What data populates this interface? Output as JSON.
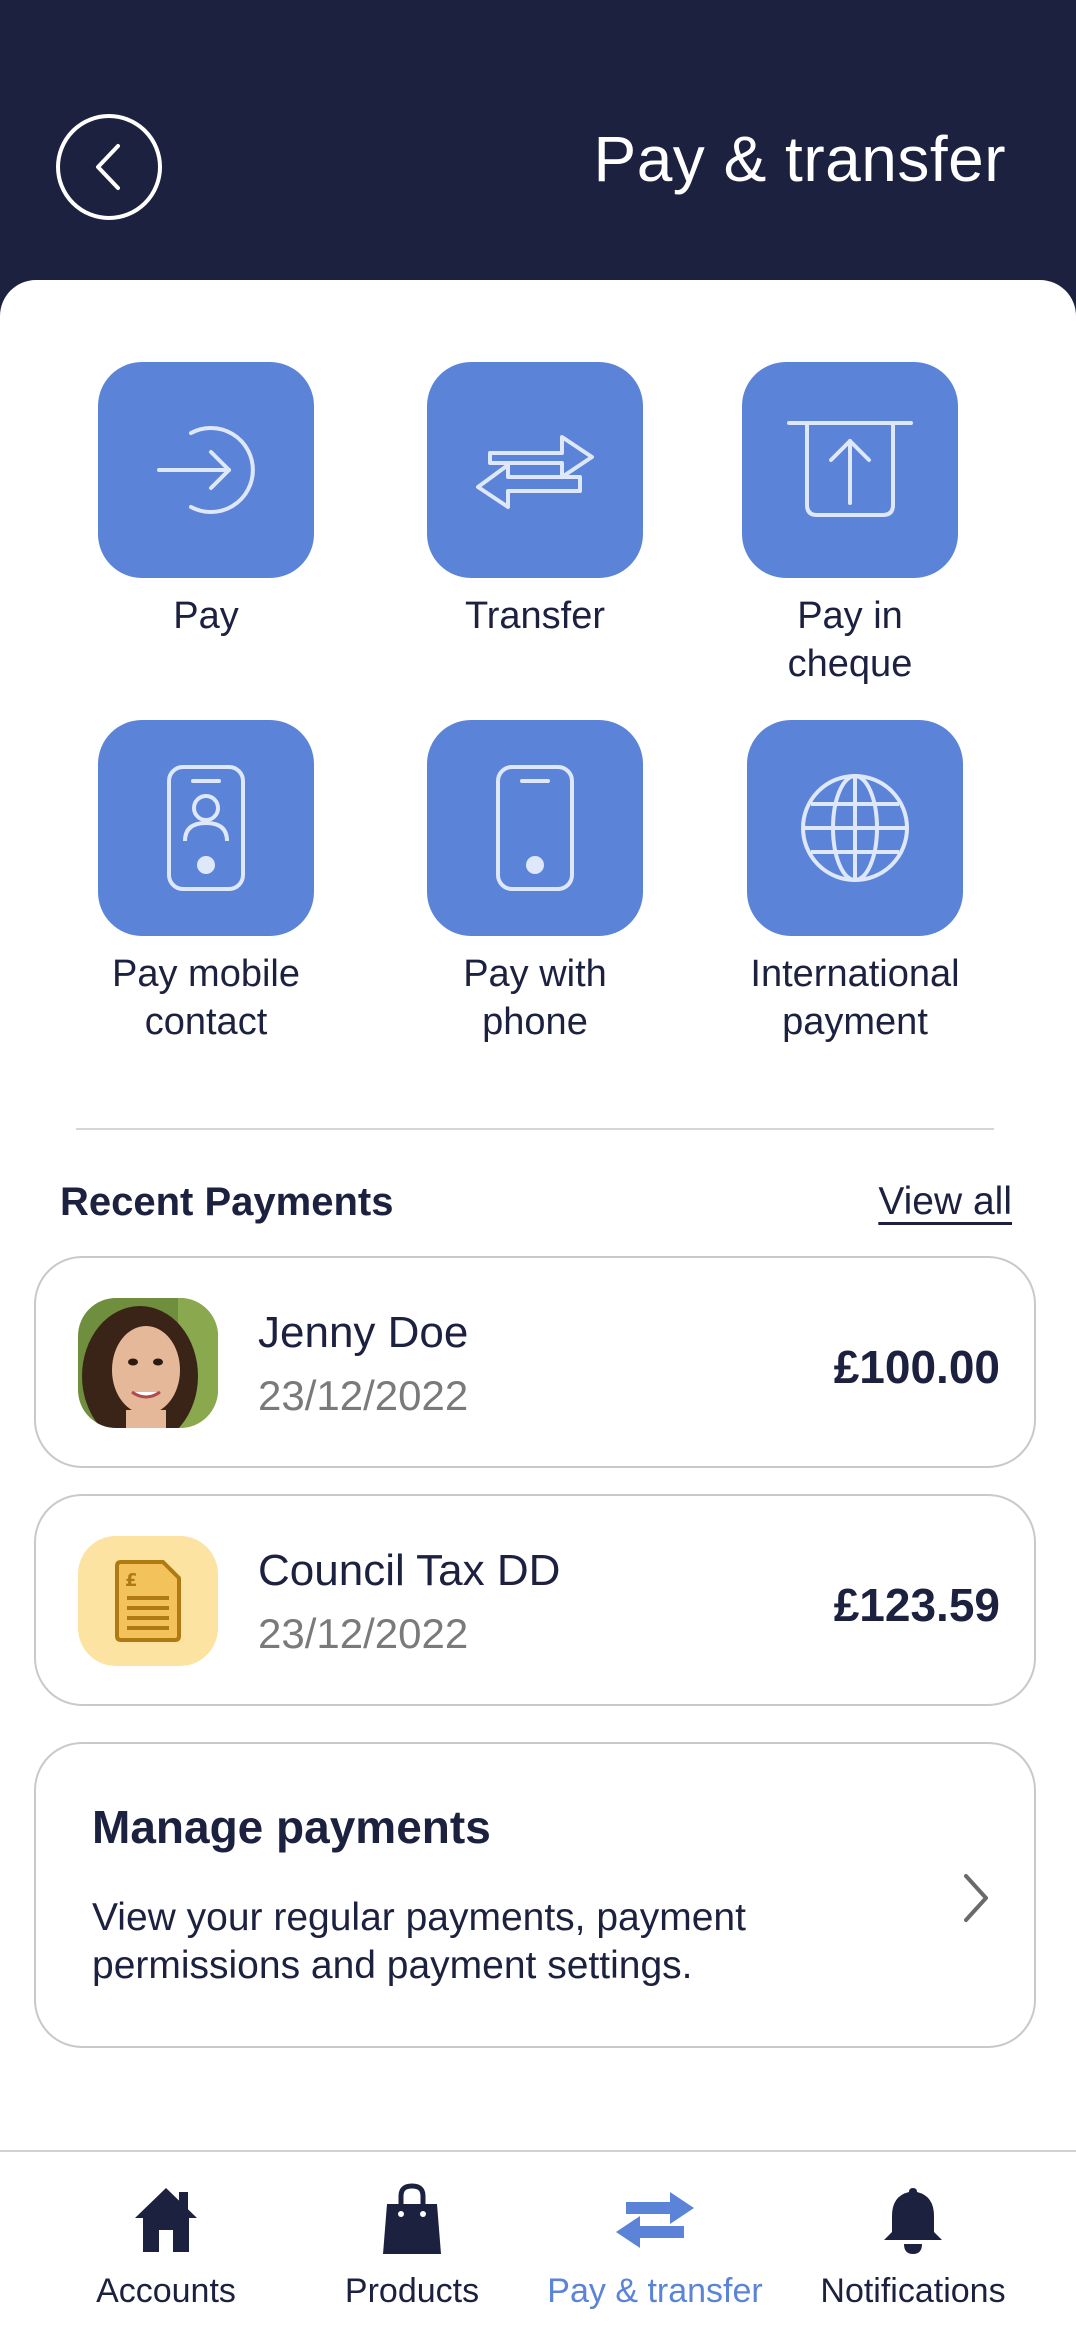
{
  "header": {
    "title": "Pay & transfer",
    "back_icon": "chevron-left-icon"
  },
  "quick_actions": [
    {
      "label": "Pay",
      "icon": "arrow-into-circle-icon"
    },
    {
      "label": "Transfer",
      "icon": "swap-arrows-icon"
    },
    {
      "label_line1": "Pay in",
      "label_line2": "cheque",
      "icon": "deposit-slot-icon"
    },
    {
      "label_line1": "Pay mobile",
      "label_line2": "contact",
      "icon": "phone-contact-icon"
    },
    {
      "label_line1": "Pay with",
      "label_line2": "phone",
      "icon": "mobile-phone-icon"
    },
    {
      "label_line1": "International",
      "label_line2": "payment",
      "icon": "globe-icon"
    }
  ],
  "recent": {
    "title": "Recent Payments",
    "view_all": "View all",
    "items": [
      {
        "name": "Jenny Doe",
        "date": "23/12/2022",
        "amount": "£100.00",
        "icon": "avatar-photo"
      },
      {
        "name": "Council Tax DD",
        "date": "23/12/2022",
        "amount": "£123.59",
        "icon": "bill-document-icon"
      }
    ]
  },
  "manage": {
    "title": "Manage payments",
    "description": "View your regular payments, payment permissions and payment settings."
  },
  "nav": {
    "items": [
      {
        "label": "Accounts",
        "icon": "home-icon"
      },
      {
        "label": "Products",
        "icon": "shopping-bag-icon"
      },
      {
        "label": "Pay & transfer",
        "icon": "swap-arrows-icon",
        "active": true
      },
      {
        "label": "Notifications",
        "icon": "bell-icon"
      }
    ]
  },
  "colors": {
    "brand_navy": "#1d2140",
    "accent_blue": "#5b84d8",
    "bill_icon_bg": "#fde3a1"
  }
}
